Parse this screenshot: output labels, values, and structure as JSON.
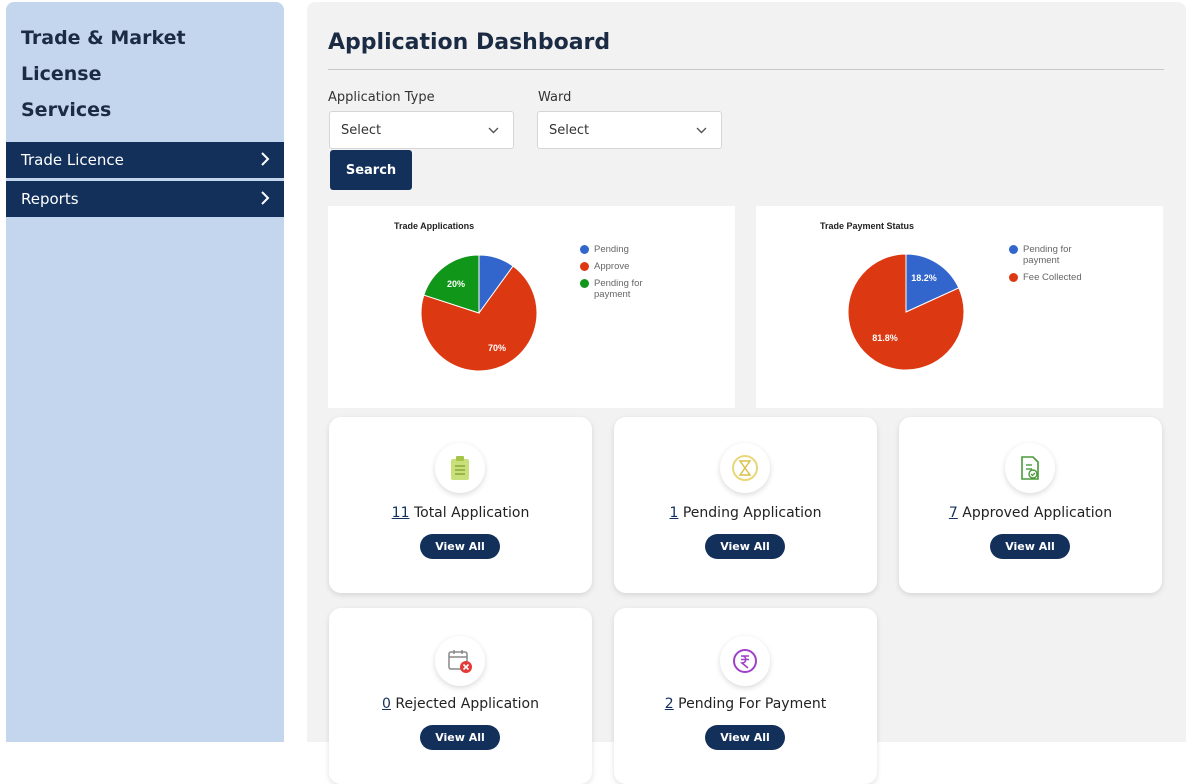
{
  "sidebar": {
    "title_line1": "Trade & Market License",
    "title_line2": "Services",
    "items": [
      {
        "label": "Trade Licence"
      },
      {
        "label": "Reports"
      }
    ]
  },
  "main": {
    "title": "Application Dashboard",
    "filters": {
      "application_type_label": "Application Type",
      "application_type_value": "Select",
      "ward_label": "Ward",
      "ward_value": "Select",
      "search_label": "Search"
    },
    "cards": [
      {
        "count": "11",
        "label": "Total Application",
        "button": "View All",
        "icon": "clipboard-icon"
      },
      {
        "count": "1",
        "label": "Pending Application",
        "button": "View All",
        "icon": "hourglass-icon"
      },
      {
        "count": "7",
        "label": "Approved Application",
        "button": "View All",
        "icon": "document-check-icon"
      },
      {
        "count": "0",
        "label": "Rejected Application",
        "button": "View All",
        "icon": "calendar-cancel-icon"
      },
      {
        "count": "2",
        "label": "Pending For Payment",
        "button": "View All",
        "icon": "rupee-icon"
      }
    ]
  },
  "chart_data": [
    {
      "type": "pie",
      "title": "Trade Applications",
      "categories": [
        "Pending",
        "Approve",
        "Pending for payment"
      ],
      "values": [
        10,
        70,
        20
      ],
      "data_labels": [
        "",
        "70%",
        "20%"
      ],
      "colors": [
        "#3366cc",
        "#dc3912",
        "#109618"
      ],
      "legend": "right"
    },
    {
      "type": "pie",
      "title": "Trade Payment Status",
      "categories": [
        "Pending for payment",
        "Fee Collected"
      ],
      "values": [
        18.2,
        81.8
      ],
      "data_labels": [
        "18.2%",
        "81.8%"
      ],
      "colors": [
        "#3366cc",
        "#dc3912"
      ],
      "legend": "right"
    }
  ],
  "colors": {
    "primary": "#13305b",
    "sidebar_bg": "#c4d6ee",
    "main_bg": "#f2f2f2"
  }
}
